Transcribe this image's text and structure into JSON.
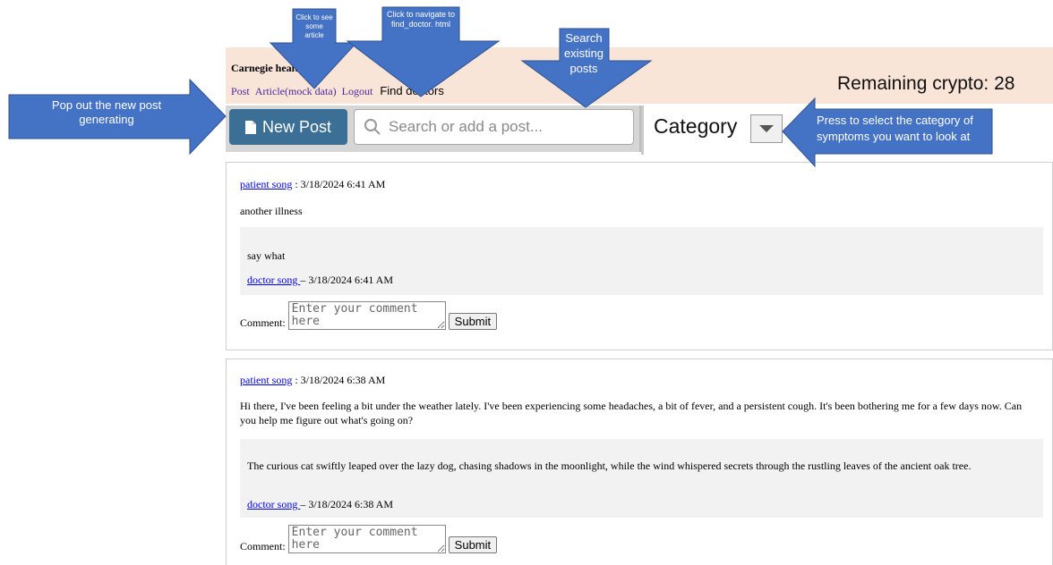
{
  "header": {
    "brand": "Carnegie health",
    "nav": [
      "Post",
      "Article(mock data)",
      "Logout"
    ],
    "find_doctors": "Find doctors",
    "remaining_crypto": "Remaining crypto: 28"
  },
  "toolbar": {
    "new_post_label": "New Post",
    "search_placeholder": "Search or add a post...",
    "category_label": "Category"
  },
  "posts": [
    {
      "author": "patient song",
      "timestamp": " : 3/18/2024 6:41 AM",
      "body": "another illness",
      "reply": {
        "text": "say what",
        "author": "doctor song ",
        "timestamp": "– 3/18/2024 6:41 AM"
      },
      "comment_label": "Comment:",
      "comment_placeholder": "Enter your comment here",
      "submit_label": "Submit"
    },
    {
      "author": "patient song",
      "timestamp": " : 3/18/2024 6:38 AM",
      "body": "Hi there, I've been feeling a bit under the weather lately. I've been experiencing some headaches, a bit of fever, and a persistent cough. It's been bothering me for a few days now. Can you help me figure out what's going on?",
      "reply": {
        "text": "The curious cat swiftly leaped over the lazy dog, chasing shadows in the moonlight, while the wind whispered secrets through the rustling leaves of the ancient oak tree.",
        "author": "doctor song ",
        "timestamp": "– 3/18/2024 6:38 AM"
      },
      "comment_label": "Comment:",
      "comment_placeholder": "Enter your comment here",
      "submit_label": "Submit"
    }
  ],
  "annotations": {
    "pop_out": "Pop out the new post generating",
    "see_article": "Click to see some article",
    "find_doctor": "Click to navigate to find_doctor. html",
    "search_posts": "Search existing posts",
    "category_hint": "Press to select the category of symptoms you want to look at"
  },
  "colors": {
    "header_bg": "#f9e4d8",
    "new_post_bg": "#3c6f96",
    "annotation_fill": "#4472c4",
    "link": "#0000ee"
  }
}
